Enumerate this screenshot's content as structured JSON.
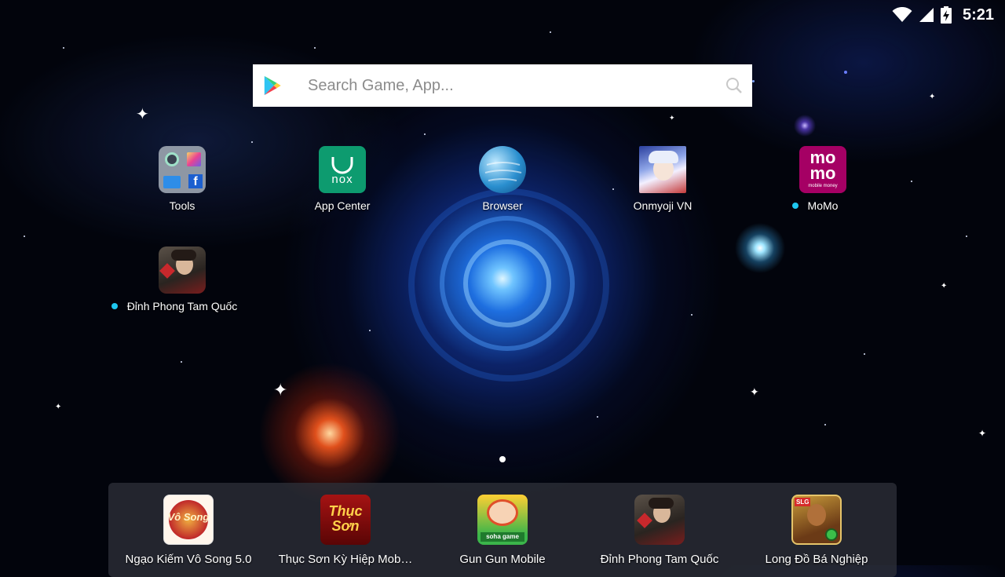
{
  "status_bar": {
    "time": "5:21"
  },
  "search": {
    "placeholder": "Search Game, App..."
  },
  "desktop_apps": [
    {
      "label": "Tools"
    },
    {
      "label": "App Center"
    },
    {
      "label": "Browser"
    },
    {
      "label": "Onmyoji VN"
    },
    {
      "label": "MoMo"
    },
    {
      "label": "Đỉnh Phong Tam Quốc"
    }
  ],
  "dock_apps": [
    {
      "label": "Ngạo Kiếm Vô Song 5.0"
    },
    {
      "label": "Thục Sơn Kỳ Hiệp Mob…"
    },
    {
      "label": "Gun Gun Mobile"
    },
    {
      "label": "Đỉnh Phong Tam Quốc"
    },
    {
      "label": "Long Đồ Bá Nghiệp"
    }
  ],
  "icon_texts": {
    "app_center_brand": "nox",
    "momo_top": "mo",
    "momo_bottom": "mo",
    "momo_sub": "mobile money",
    "thuc_son_logo": "Thục Sơn",
    "ngao_kiem_logo": "Vô Song",
    "gungun_logo": "soha game",
    "long_do_badge": "SLG"
  },
  "colors": {
    "app_center": "#0d9b6f",
    "momo": "#a50064",
    "new_dot": "#1ec8f0"
  }
}
